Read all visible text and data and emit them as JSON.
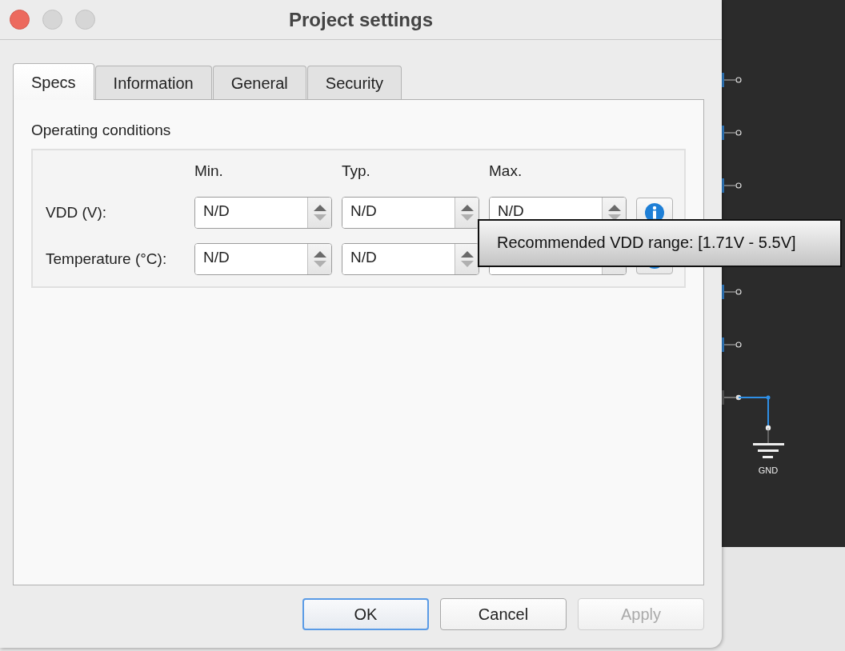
{
  "window": {
    "title": "Project settings"
  },
  "tabs": [
    {
      "label": "Specs",
      "selected": true
    },
    {
      "label": "Information",
      "selected": false
    },
    {
      "label": "General",
      "selected": false
    },
    {
      "label": "Security",
      "selected": false
    }
  ],
  "group": {
    "title": "Operating conditions",
    "columns": [
      "Min.",
      "Typ.",
      "Max."
    ],
    "rows": [
      {
        "label": "VDD (V):",
        "values": [
          "N/D",
          "N/D",
          "N/D"
        ]
      },
      {
        "label": "Temperature (°C):",
        "values": [
          "N/D",
          "N/D"
        ]
      }
    ]
  },
  "tooltip": {
    "text": "Recommended VDD range: [1.71V - 5.5V]"
  },
  "buttons": [
    {
      "label": "OK",
      "default": true,
      "disabled": false
    },
    {
      "label": "Cancel",
      "default": false,
      "disabled": false
    },
    {
      "label": "Apply",
      "default": false,
      "disabled": true
    }
  ],
  "schematic": {
    "ground_label": "GND"
  }
}
